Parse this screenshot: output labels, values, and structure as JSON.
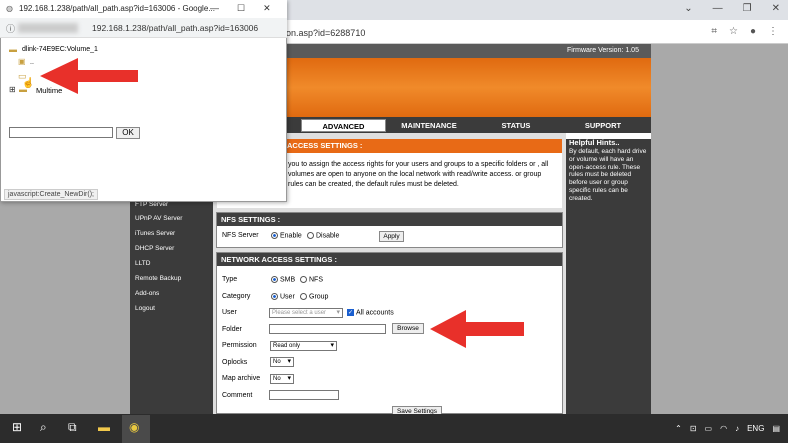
{
  "main_browser": {
    "url": "on.asp?id=6288710",
    "controls": [
      "⌄",
      "—",
      "❐",
      "✕"
    ]
  },
  "router": {
    "firmware": "Firmware Version: 1.05",
    "tabs": [
      "ADVANCED",
      "MAINTENANCE",
      "STATUS",
      "SUPPORT"
    ],
    "left_nav": [
      "FTP Server",
      "UPnP AV Server",
      "iTunes Server",
      "DHCP Server",
      "LLTD",
      "Remote Backup",
      "Add-ons",
      "Logout"
    ],
    "access_header": "ACCESS SETTINGS :",
    "access_text": "you to assign the access rights for your users and groups to a specific folders or , all volumes are open to anyone on the local network with read/write access. or group rules can be created, the default rules must be deleted.",
    "hints_title": "Helpful Hints..",
    "hints_text": "By default, each hard drive or volume will have an open-access rule. These rules must be deleted before user or group specific rules can be created.",
    "nfs": {
      "header": "NFS SETTINGS :",
      "label": "NFS Server",
      "enable": "Enable",
      "disable": "Disable",
      "apply": "Apply"
    },
    "net": {
      "header": "NETWORK ACCESS SETTINGS :",
      "type_label": "Type",
      "smb": "SMB",
      "nfs": "NFS",
      "category_label": "Category",
      "user_opt": "User",
      "group_opt": "Group",
      "user_label": "User",
      "user_select": "Please select a user",
      "all_accounts": "All accounts",
      "folder_label": "Folder",
      "browse": "Browse",
      "permission_label": "Permission",
      "permission_value": "Read only",
      "oplocks_label": "Oplocks",
      "oplocks_value": "No",
      "maparchive_label": "Map archive",
      "maparchive_value": "No",
      "comment_label": "Comment",
      "save": "Save Settings"
    }
  },
  "popup": {
    "title": "192.168.1.238/path/all_path.asp?id=163006 - Google...",
    "url": "192.168.1.238/path/all_path.asp?id=163006",
    "controls": [
      "—",
      "☐",
      "✕"
    ],
    "tree_root": "dlink-74E9EC:Volume_1",
    "tree_dots": "..",
    "tree_multi": "Multime",
    "ok": "OK",
    "status": "javascript:Create_NewDir();"
  },
  "taskbar": {
    "lang": "ENG"
  },
  "colors": {
    "accent_orange": "#e86a16",
    "arrow_red": "#e8302a",
    "nav_dark": "#3b3b3b"
  }
}
